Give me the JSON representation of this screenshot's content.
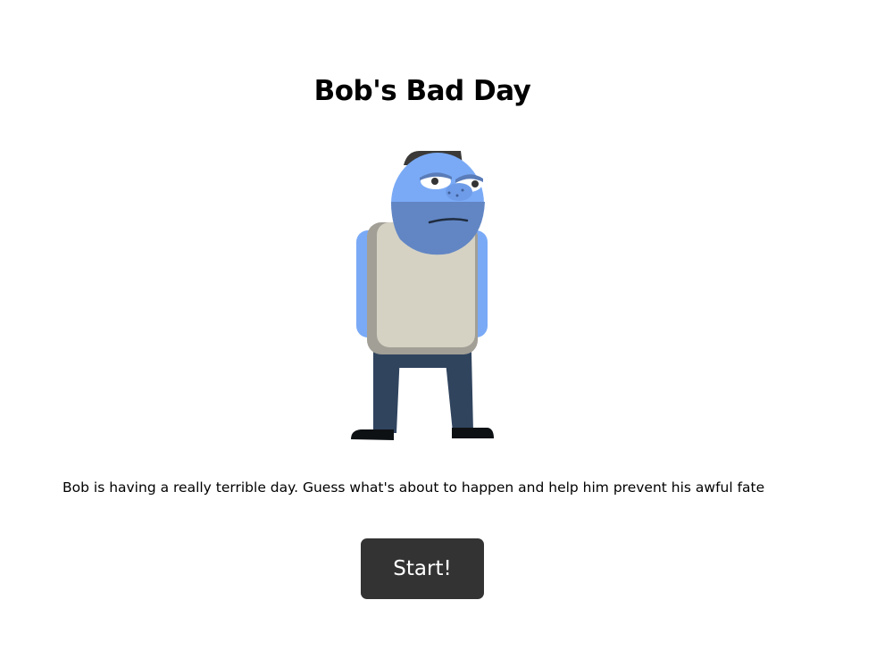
{
  "page": {
    "title": "Bob's Bad Day",
    "description": "Bob is having a really terrible day. Guess what's about to happen and help him prevent his awful fate",
    "start_button_label": "Start!"
  },
  "character": {
    "icon": "bob-character-illustration",
    "colors": {
      "skin": "#7aaaf6",
      "skin_shade": "#6286c4",
      "hair": "#3b3a38",
      "sweater": "#d5d2c4",
      "sweater_trim": "#a29f96",
      "pants": "#30445e",
      "shoes": "#0e1114"
    }
  },
  "theme": {
    "background": "#ffffff",
    "button_bg": "#333333",
    "button_text": "#ffffff"
  }
}
